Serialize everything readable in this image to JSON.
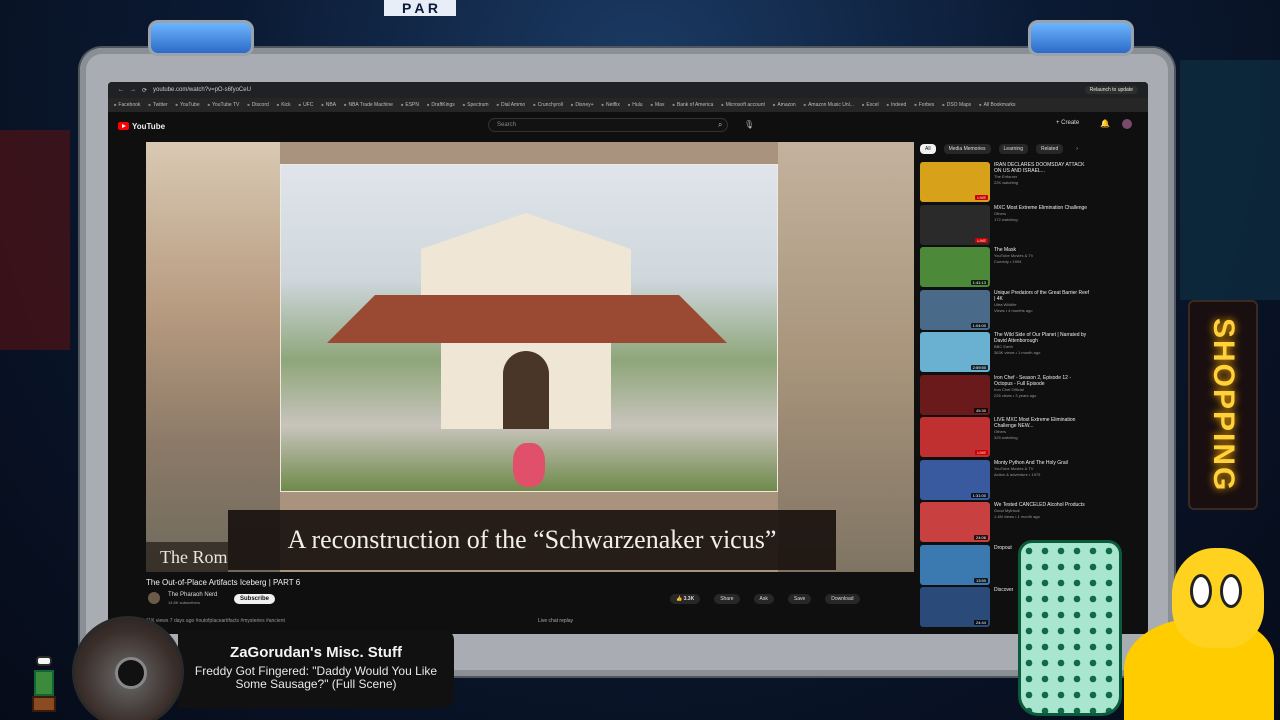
{
  "background": {
    "top_sign": "P A R",
    "shop_sign": "SHOPPING"
  },
  "browser": {
    "url": "youtube.com/watch?v=pO-s6fyoCeU",
    "relaunch_label": "Relaunch to update",
    "bookmarks": [
      "Facebook",
      "Twitter",
      "YouTube",
      "YouTube TV",
      "Discord",
      "Kick",
      "UFC",
      "NBA",
      "NBA Trade Machine",
      "ESPN",
      "DraftKings",
      "Spectrum",
      "Dial Ammo",
      "Crunchyroll",
      "Disney+",
      "Netflix",
      "Hulu",
      "Max",
      "Bank of America",
      "Microsoft account",
      "Amazon",
      "Amazon Music Unl...",
      "Excel",
      "Indeed",
      "Forbes",
      "DSO Maps",
      "All Bookmarks"
    ]
  },
  "youtube": {
    "logo_text": "YouTube",
    "search_placeholder": "Search",
    "create_label": "+ Create",
    "video": {
      "subtitle": "A reconstruction of the “Schwarzenaker vicus”",
      "caption_left": "The Roman",
      "title": "The Out-of-Place Artifacts Iceberg | PART 6",
      "channel": "The Pharaoh Nerd",
      "subscribers": "14.8K subscribers",
      "subscribe_label": "Subscribe",
      "likes": "3.3K",
      "share": "Share",
      "ask": "Ask",
      "save": "Save",
      "download": "Download",
      "description": "11K views  7 days ago  #outofplaceartifacts #mysteries #ancient",
      "live_chat": "Live chat replay"
    },
    "chips": [
      "All",
      "Media Memories",
      "Learning",
      "Related"
    ],
    "recommendations": [
      {
        "title": "IRAN DECLARES DOOMSDAY ATTACK ON US AND ISRAEL...",
        "channel": "The Enforcer",
        "meta": "22K watching",
        "badge": "LIVE",
        "color": "#d8a11a"
      },
      {
        "title": "MXC Most Extreme Elimination Challenge",
        "channel": "Others",
        "meta": "172 watching",
        "badge": "LIVE",
        "color": "#2a2a2a"
      },
      {
        "title": "The Mask",
        "channel": "YouTube Movies & TV",
        "meta": "Comedy • 1994",
        "badge": "1:41:13",
        "color": "#4c8a3a"
      },
      {
        "title": "Unique Predators of the Great Barrier Reef | 4K",
        "channel": "Ultra Wildlife",
        "meta": "Views • 4 months ago",
        "badge": "1:04:00",
        "color": "#4a6a8a"
      },
      {
        "title": "The Wild Side of Our Planet | Narrated by David Attenborough",
        "channel": "BBC Earth",
        "meta": "363K views • 1 month ago",
        "badge": "2:59:50",
        "color": "#6ab0d0"
      },
      {
        "title": "Iron Chef - Season 2, Episode 12 - Octopus - Full Episode",
        "channel": "Iron Chef Official",
        "meta": "226 views • 3 years ago",
        "badge": "45:30",
        "color": "#6a1a1a"
      },
      {
        "title": "LIVE MXC Most Extreme Elimination Challenge NEW...",
        "channel": "Others",
        "meta": "325 watching",
        "badge": "LIVE",
        "color": "#c03030"
      },
      {
        "title": "Monty Python And The Holy Grail",
        "channel": "YouTube Movies & TV",
        "meta": "Action & adventure • 1975",
        "badge": "1:31:00",
        "color": "#3a5aa0"
      },
      {
        "title": "We Tested CANCELED Alcohol Products",
        "channel": "Good Mythical",
        "meta": "1.4M views • 1 month ago",
        "badge": "24:06",
        "color": "#c84040"
      },
      {
        "title": "Dropout",
        "channel": "",
        "meta": "",
        "badge": "13:50",
        "color": "#3a7ab0"
      },
      {
        "title": "Discover",
        "channel": "",
        "meta": "",
        "badge": "24:44",
        "color": "#2a4a7a"
      }
    ]
  },
  "now_playing": {
    "channel": "ZaGorudan's Misc. Stuff",
    "song": "Freddy Got Fingered: \"Daddy Would You Like Some Sausage?\" (Full Scene)"
  }
}
